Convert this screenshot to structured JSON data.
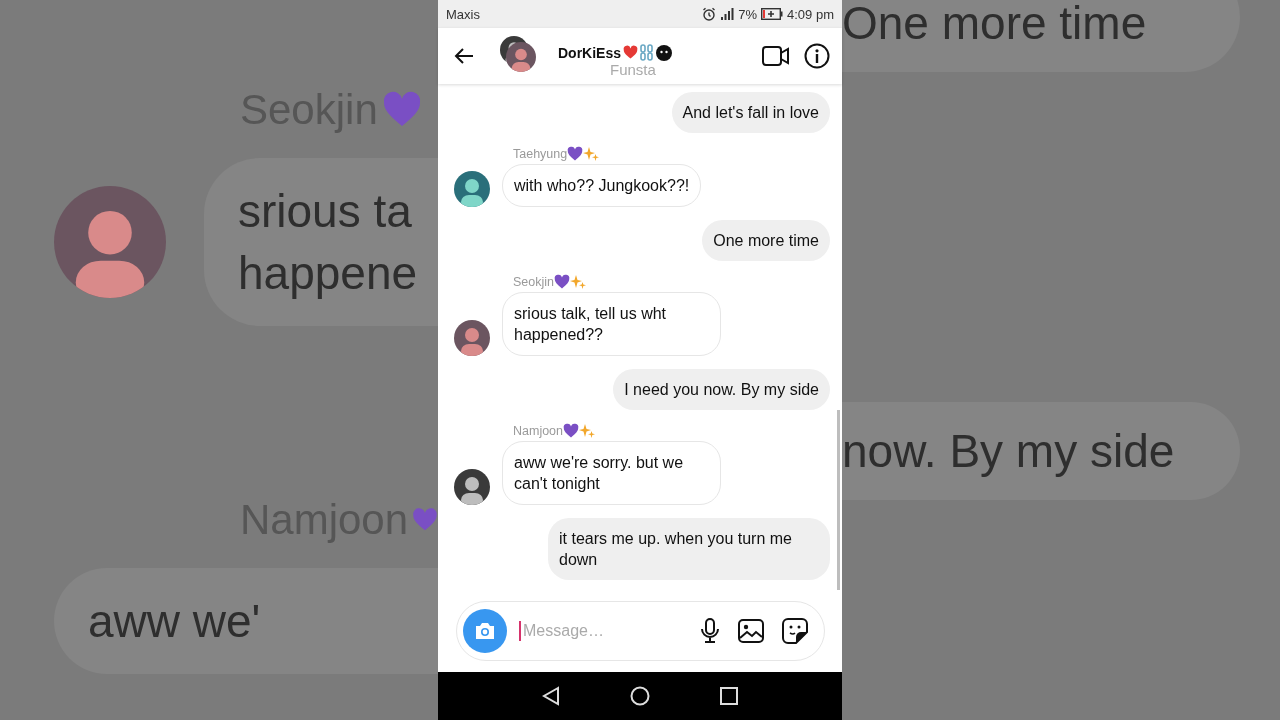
{
  "backdrop": {
    "left": [
      {
        "kind": "name",
        "text": "Seokjin"
      },
      {
        "kind": "bubble",
        "lines": [
          "srious ta",
          "happene"
        ]
      },
      {
        "kind": "name",
        "text": "Namjoon"
      },
      {
        "kind": "bubble",
        "lines": [
          "aww we'"
        ]
      }
    ],
    "right": [
      {
        "kind": "bubble",
        "lines": [
          "One more time"
        ]
      },
      {
        "kind": "bubble",
        "lines": [
          "now. By my side"
        ]
      }
    ]
  },
  "status_bar": {
    "carrier": "Maxis",
    "battery": "7%",
    "time": "4:09 pm"
  },
  "header": {
    "title": "DorKiEss",
    "subtitle": "Funsta"
  },
  "messages": [
    {
      "kind": "outgoing",
      "text": "And let's fall in love"
    },
    {
      "kind": "incoming",
      "sender": "Taehyung",
      "text": "with who?? Jungkook??!"
    },
    {
      "kind": "outgoing",
      "text": "One more time"
    },
    {
      "kind": "incoming",
      "sender": "Seokjin",
      "text": "srious talk, tell us wht happened??"
    },
    {
      "kind": "outgoing",
      "text": "I need you now. By my side"
    },
    {
      "kind": "incoming",
      "sender": "Namjoon",
      "text": "aww we're sorry. but we can't tonight"
    },
    {
      "kind": "outgoing",
      "text": "it tears me up. when you turn me down"
    }
  ],
  "composer": {
    "placeholder": "Message…"
  }
}
